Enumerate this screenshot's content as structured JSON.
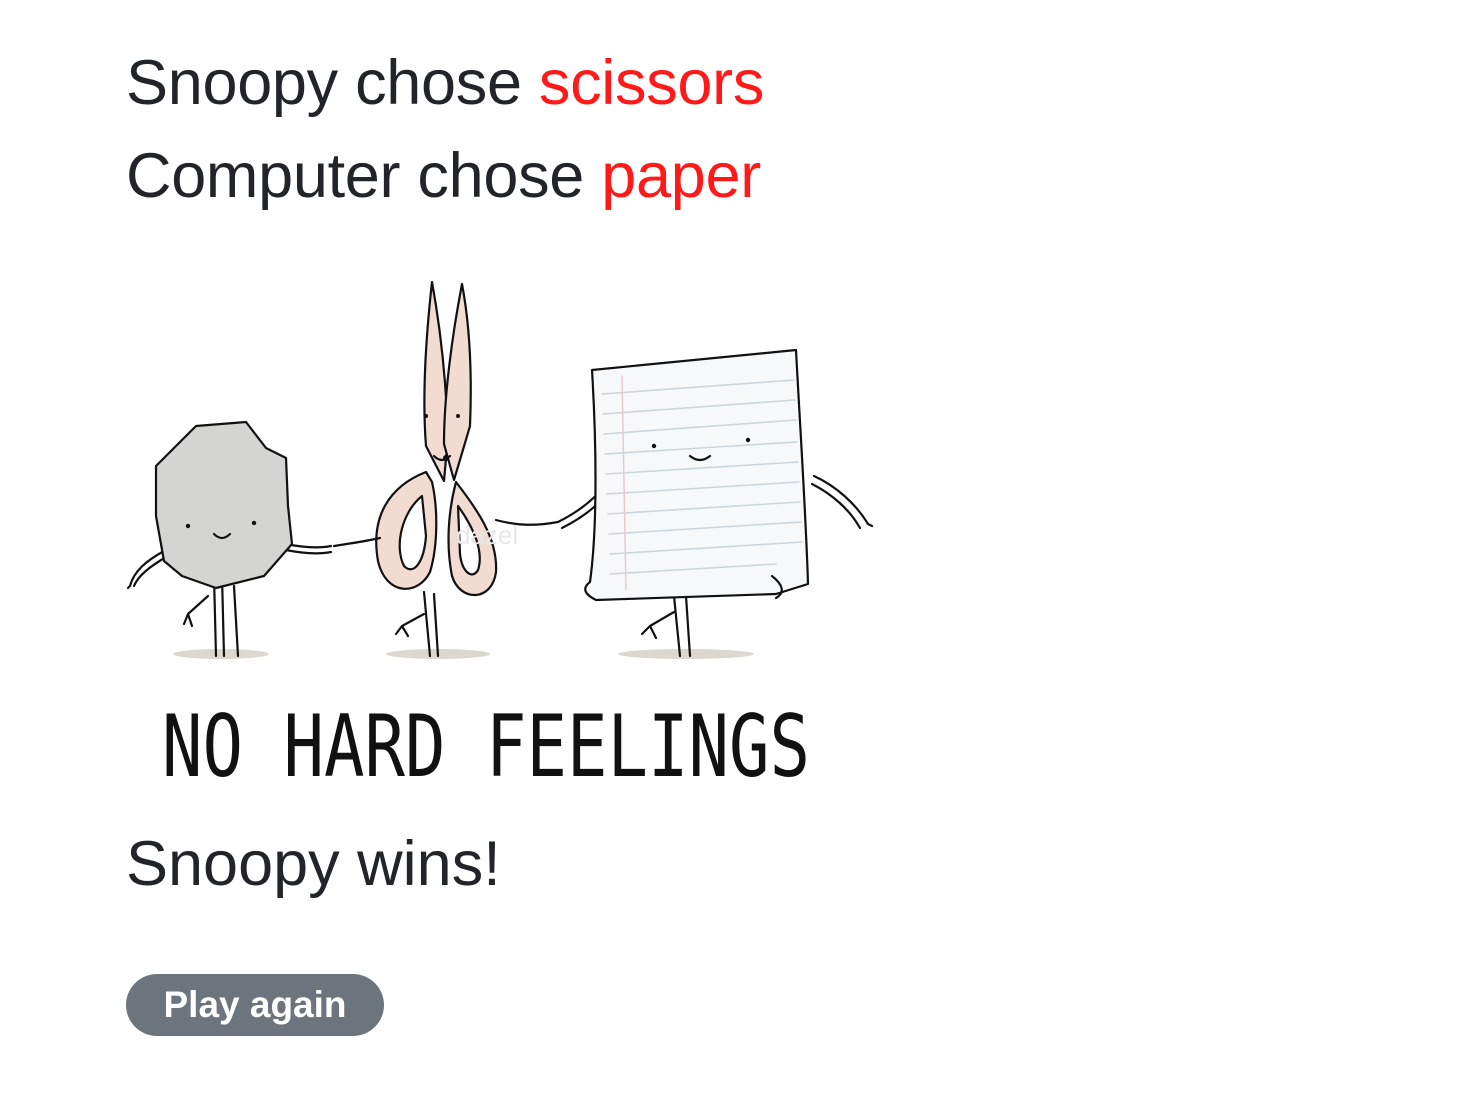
{
  "result_lines": {
    "player_prefix": "Snoopy chose",
    "player_choice": "scissors",
    "computer_prefix": "Computer chose",
    "computer_choice": "paper"
  },
  "illustration": {
    "caption": "NO HARD FEELINGS",
    "watermark": "dazel"
  },
  "outcome": "Snoopy wins!",
  "actions": {
    "play_again_label": "Play again"
  },
  "colors": {
    "choice_accent": "#ff1a1a",
    "text": "#212529",
    "button_bg": "#6c757d"
  }
}
